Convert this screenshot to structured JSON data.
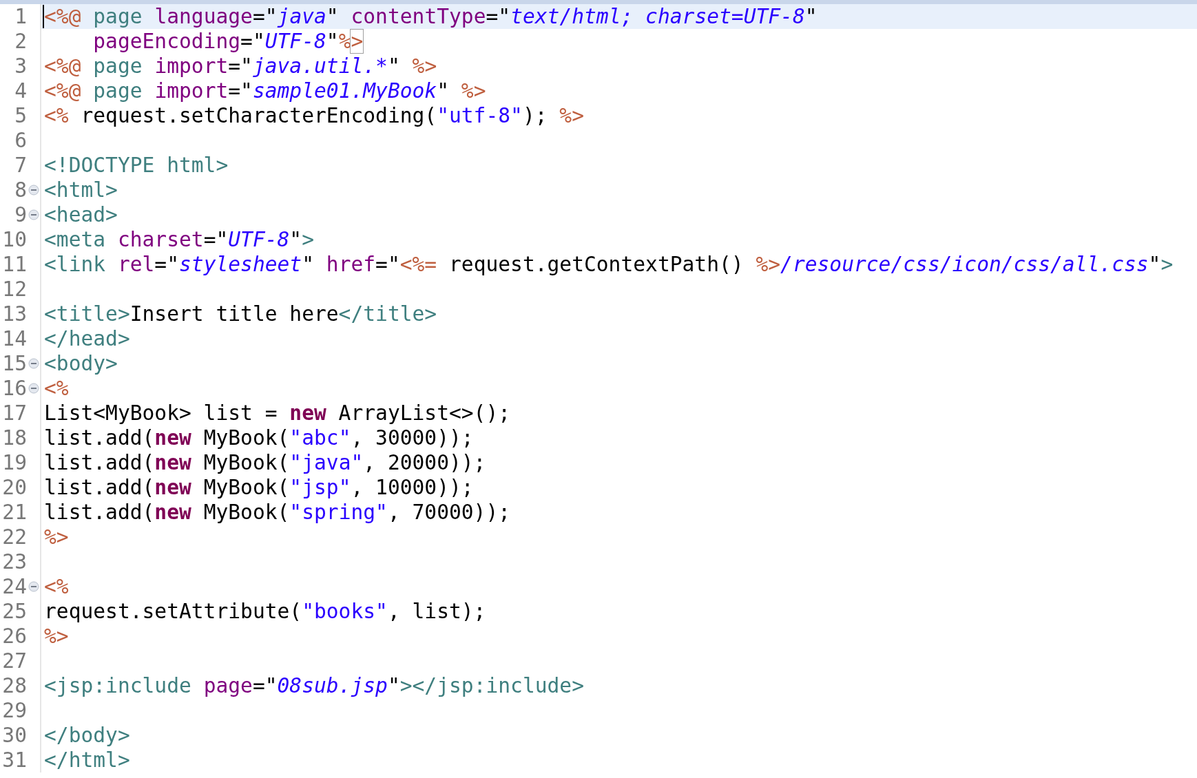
{
  "lines": [
    {
      "number": "1",
      "foldable": false,
      "current": true,
      "tokens": [
        {
          "kind": "jsp",
          "text": "<%@ "
        },
        {
          "kind": "tag",
          "text": "page "
        },
        {
          "kind": "attr",
          "text": "language"
        },
        {
          "kind": "text",
          "text": "=\""
        },
        {
          "kind": "value",
          "text": "java"
        },
        {
          "kind": "text",
          "text": "\" "
        },
        {
          "kind": "attr",
          "text": "contentType"
        },
        {
          "kind": "text",
          "text": "=\""
        },
        {
          "kind": "value",
          "text": "text/html; charset=UTF-8"
        },
        {
          "kind": "text",
          "text": "\""
        }
      ]
    },
    {
      "number": "2",
      "foldable": false,
      "current": false,
      "tokens": [
        {
          "kind": "attr",
          "text": "    pageEncoding"
        },
        {
          "kind": "text",
          "text": "=\""
        },
        {
          "kind": "value",
          "text": "UTF-8"
        },
        {
          "kind": "text",
          "text": "\""
        },
        {
          "kind": "jsp",
          "text": "%"
        },
        {
          "kind": "jsp",
          "text": ">",
          "matched": true
        }
      ]
    },
    {
      "number": "3",
      "foldable": false,
      "current": false,
      "tokens": [
        {
          "kind": "jsp",
          "text": "<%@ "
        },
        {
          "kind": "tag",
          "text": "page "
        },
        {
          "kind": "attr",
          "text": "import"
        },
        {
          "kind": "text",
          "text": "=\""
        },
        {
          "kind": "value",
          "text": "java.util.*"
        },
        {
          "kind": "text",
          "text": "\" "
        },
        {
          "kind": "jsp",
          "text": "%>"
        }
      ]
    },
    {
      "number": "4",
      "foldable": false,
      "current": false,
      "tokens": [
        {
          "kind": "jsp",
          "text": "<%@ "
        },
        {
          "kind": "tag",
          "text": "page "
        },
        {
          "kind": "attr",
          "text": "import"
        },
        {
          "kind": "text",
          "text": "=\""
        },
        {
          "kind": "value",
          "text": "sample01.MyBook"
        },
        {
          "kind": "text",
          "text": "\" "
        },
        {
          "kind": "jsp",
          "text": "%>"
        }
      ]
    },
    {
      "number": "5",
      "foldable": false,
      "current": false,
      "tokens": [
        {
          "kind": "jsp",
          "text": "<%"
        },
        {
          "kind": "text",
          "text": " request.setCharacterEncoding("
        },
        {
          "kind": "string",
          "text": "\"utf-8\""
        },
        {
          "kind": "text",
          "text": "); "
        },
        {
          "kind": "jsp",
          "text": "%>"
        }
      ]
    },
    {
      "number": "6",
      "foldable": false,
      "current": false
    },
    {
      "number": "7",
      "foldable": false,
      "current": false,
      "tokens": [
        {
          "kind": "tag",
          "text": "<!DOCTYPE html>"
        }
      ]
    },
    {
      "number": "8",
      "foldable": true,
      "current": false,
      "tokens": [
        {
          "kind": "tag",
          "text": "<html>"
        }
      ]
    },
    {
      "number": "9",
      "foldable": true,
      "current": false,
      "tokens": [
        {
          "kind": "tag",
          "text": "<head>"
        }
      ]
    },
    {
      "number": "10",
      "foldable": false,
      "current": false,
      "tokens": [
        {
          "kind": "tag",
          "text": "<meta "
        },
        {
          "kind": "attr",
          "text": "charset"
        },
        {
          "kind": "text",
          "text": "=\""
        },
        {
          "kind": "value",
          "text": "UTF-8"
        },
        {
          "kind": "text",
          "text": "\""
        },
        {
          "kind": "tag",
          "text": ">"
        }
      ]
    },
    {
      "number": "11",
      "foldable": false,
      "current": false,
      "tokens": [
        {
          "kind": "tag",
          "text": "<link "
        },
        {
          "kind": "attr",
          "text": "rel"
        },
        {
          "kind": "text",
          "text": "=\""
        },
        {
          "kind": "value",
          "text": "stylesheet"
        },
        {
          "kind": "text",
          "text": "\" "
        },
        {
          "kind": "attr",
          "text": "href"
        },
        {
          "kind": "text",
          "text": "=\""
        },
        {
          "kind": "jsp",
          "text": "<%="
        },
        {
          "kind": "text",
          "text": " request.getContextPath() "
        },
        {
          "kind": "jsp",
          "text": "%>"
        },
        {
          "kind": "value",
          "text": "/resource/css/icon/css/all.css"
        },
        {
          "kind": "text",
          "text": "\""
        },
        {
          "kind": "tag",
          "text": ">"
        }
      ]
    },
    {
      "number": "12",
      "foldable": false,
      "current": false
    },
    {
      "number": "13",
      "foldable": false,
      "current": false,
      "tokens": [
        {
          "kind": "tag",
          "text": "<title>"
        },
        {
          "kind": "text",
          "text": "Insert title here"
        },
        {
          "kind": "tag",
          "text": "</title>"
        }
      ]
    },
    {
      "number": "14",
      "foldable": false,
      "current": false,
      "tokens": [
        {
          "kind": "tag",
          "text": "</head>"
        }
      ]
    },
    {
      "number": "15",
      "foldable": true,
      "current": false,
      "tokens": [
        {
          "kind": "tag",
          "text": "<body>"
        }
      ]
    },
    {
      "number": "16",
      "foldable": true,
      "current": false,
      "tokens": [
        {
          "kind": "jsp",
          "text": "<%"
        }
      ]
    },
    {
      "number": "17",
      "foldable": false,
      "current": false,
      "tokens": [
        {
          "kind": "text",
          "text": "List<MyBook> list = "
        },
        {
          "kind": "keyword",
          "text": "new"
        },
        {
          "kind": "text",
          "text": " ArrayList<>();"
        }
      ]
    },
    {
      "number": "18",
      "foldable": false,
      "current": false,
      "tokens": [
        {
          "kind": "text",
          "text": "list.add("
        },
        {
          "kind": "keyword",
          "text": "new"
        },
        {
          "kind": "text",
          "text": " MyBook("
        },
        {
          "kind": "string",
          "text": "\"abc\""
        },
        {
          "kind": "text",
          "text": ", 30000));"
        }
      ]
    },
    {
      "number": "19",
      "foldable": false,
      "current": false,
      "tokens": [
        {
          "kind": "text",
          "text": "list.add("
        },
        {
          "kind": "keyword",
          "text": "new"
        },
        {
          "kind": "text",
          "text": " MyBook("
        },
        {
          "kind": "string",
          "text": "\"java\""
        },
        {
          "kind": "text",
          "text": ", 20000));"
        }
      ]
    },
    {
      "number": "20",
      "foldable": false,
      "current": false,
      "tokens": [
        {
          "kind": "text",
          "text": "list.add("
        },
        {
          "kind": "keyword",
          "text": "new"
        },
        {
          "kind": "text",
          "text": " MyBook("
        },
        {
          "kind": "string",
          "text": "\"jsp\""
        },
        {
          "kind": "text",
          "text": ", 10000));"
        }
      ]
    },
    {
      "number": "21",
      "foldable": false,
      "current": false,
      "tokens": [
        {
          "kind": "text",
          "text": "list.add("
        },
        {
          "kind": "keyword",
          "text": "new"
        },
        {
          "kind": "text",
          "text": " MyBook("
        },
        {
          "kind": "string",
          "text": "\"spring\""
        },
        {
          "kind": "text",
          "text": ", 70000));"
        }
      ]
    },
    {
      "number": "22",
      "foldable": false,
      "current": false,
      "tokens": [
        {
          "kind": "jsp",
          "text": "%>"
        }
      ]
    },
    {
      "number": "23",
      "foldable": false,
      "current": false
    },
    {
      "number": "24",
      "foldable": true,
      "current": false,
      "tokens": [
        {
          "kind": "jsp",
          "text": "<%"
        }
      ]
    },
    {
      "number": "25",
      "foldable": false,
      "current": false,
      "tokens": [
        {
          "kind": "text",
          "text": "request.setAttribute("
        },
        {
          "kind": "string",
          "text": "\"books\""
        },
        {
          "kind": "text",
          "text": ", list);"
        }
      ]
    },
    {
      "number": "26",
      "foldable": false,
      "current": false,
      "tokens": [
        {
          "kind": "jsp",
          "text": "%>"
        }
      ]
    },
    {
      "number": "27",
      "foldable": false,
      "current": false
    },
    {
      "number": "28",
      "foldable": false,
      "current": false,
      "tokens": [
        {
          "kind": "tag",
          "text": "<jsp:include "
        },
        {
          "kind": "attr",
          "text": "page"
        },
        {
          "kind": "text",
          "text": "=\""
        },
        {
          "kind": "value",
          "text": "08sub.jsp"
        },
        {
          "kind": "text",
          "text": "\""
        },
        {
          "kind": "tag",
          "text": "></jsp:include>"
        }
      ]
    },
    {
      "number": "29",
      "foldable": false,
      "current": false
    },
    {
      "number": "30",
      "foldable": false,
      "current": false,
      "tokens": [
        {
          "kind": "tag",
          "text": "</body>"
        }
      ]
    },
    {
      "number": "31",
      "foldable": false,
      "current": false,
      "tokens": [
        {
          "kind": "tag",
          "text": "</html>"
        }
      ]
    }
  ]
}
